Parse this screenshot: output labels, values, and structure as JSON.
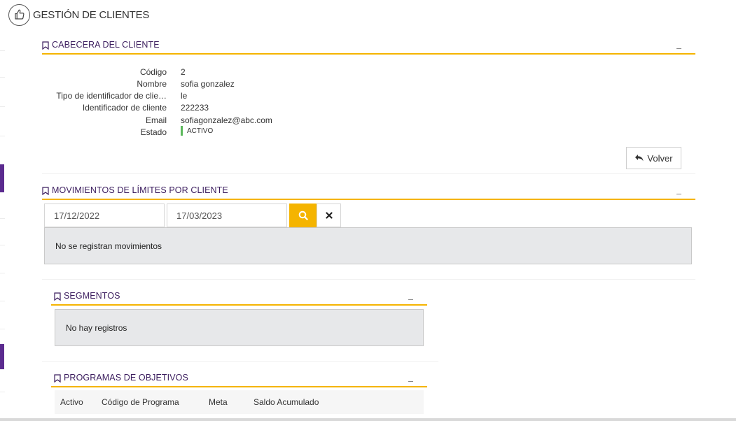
{
  "page": {
    "title": "GESTIÓN DE CLIENTES",
    "header_icon": "thumbs-up-icon"
  },
  "colors": {
    "accent": "#f5b400",
    "title_purple": "#3b1d5e",
    "status_active": "#5cb85c",
    "nav_marker": "#5b2b8f"
  },
  "cabecera": {
    "title": "CABECERA DEL CLIENTE",
    "fields": [
      {
        "label": "Código",
        "value": "2"
      },
      {
        "label": "Nombre",
        "value": "sofia gonzalez"
      },
      {
        "label": "Tipo de identificador de clie…",
        "value": "le"
      },
      {
        "label": "Identificador de cliente",
        "value": "222233"
      },
      {
        "label": "Email",
        "value": "sofiagonzalez@abc.com"
      },
      {
        "label": "Estado",
        "value": "ACTIVO"
      }
    ],
    "back_button": "Volver"
  },
  "movimientos": {
    "title": "MOVIMIENTOS DE LÍMITES POR CLIENTE",
    "date_from": "17/12/2022",
    "date_to": "17/03/2023",
    "empty_message": "No se registran movimientos"
  },
  "segmentos": {
    "title": "SEGMENTOS",
    "empty_message": "No hay registros"
  },
  "programas": {
    "title": "PROGRAMAS DE OBJETIVOS",
    "columns": [
      "Activo",
      "Código de Programa",
      "Meta",
      "Saldo Acumulado"
    ]
  }
}
